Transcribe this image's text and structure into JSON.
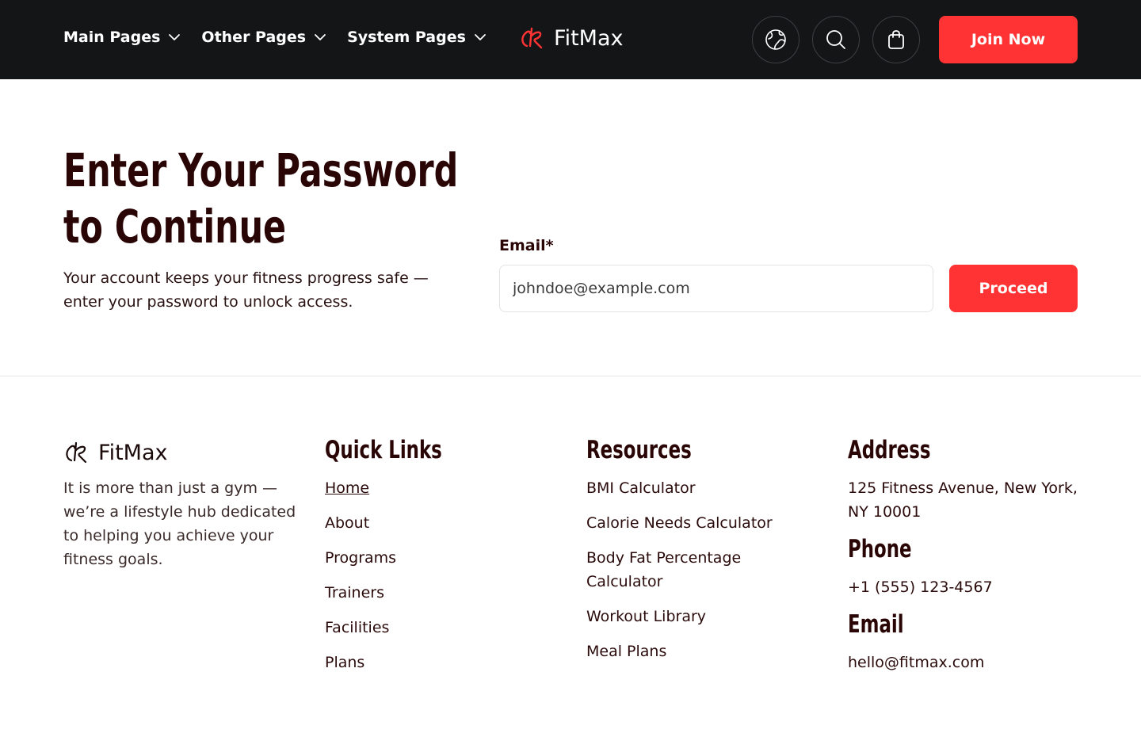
{
  "nav": {
    "menu": [
      {
        "label": "Main Pages"
      },
      {
        "label": "Other Pages"
      },
      {
        "label": "System Pages"
      }
    ],
    "brand": "FitMax",
    "join_label": "Join Now",
    "icons": [
      "globe-icon",
      "search-icon",
      "shopping-bag-icon"
    ]
  },
  "hero": {
    "title": "Enter Your Password to Continue",
    "subtitle": "Your account keeps your fitness progress safe — enter your password to unlock access.",
    "email_label": "Email*",
    "email_placeholder": "johndoe@example.com",
    "proceed_label": "Proceed"
  },
  "footer": {
    "brand": "FitMax",
    "description": "It is more than just a gym — we’re a lifestyle hub dedicated to helping you achieve your fitness goals.",
    "quick_links": {
      "title": "Quick Links",
      "items": [
        "Home",
        "About",
        "Programs",
        "Trainers",
        "Facilities",
        "Plans"
      ]
    },
    "resources": {
      "title": "Resources",
      "items": [
        "BMI Calculator",
        "Calorie Needs Calculator",
        "Body Fat Percentage Calculator",
        "Workout Library",
        "Meal Plans"
      ]
    },
    "address": {
      "title": "Address",
      "value": "125 Fitness Avenue, New York, NY 10001"
    },
    "phone": {
      "title": "Phone",
      "value": "+1 (555) 123-4567"
    },
    "email": {
      "title": "Email",
      "value": "hello@fitmax.com"
    }
  },
  "colors": {
    "accent": "#ff3333",
    "nav_bg": "#141517",
    "heading": "#2a0505"
  }
}
